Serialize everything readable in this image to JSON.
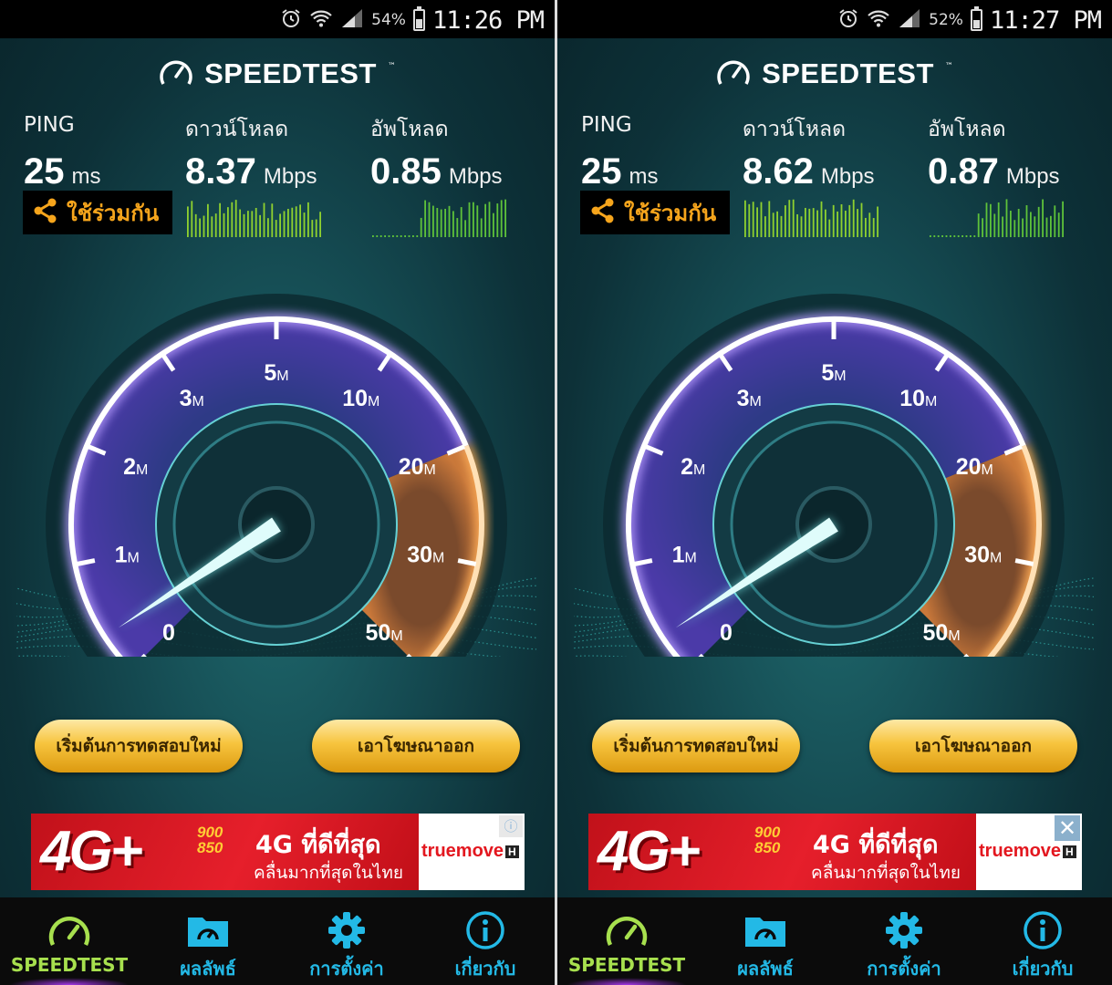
{
  "screens": [
    {
      "status_bar": {
        "battery_pct": "54%",
        "time": "11:26 PM",
        "battery_level": 0.54
      },
      "logo_text": "SPEEDTEST",
      "ping": {
        "label": "PING",
        "value": "25",
        "unit": "ms"
      },
      "download": {
        "label": "ดาวน์โหลด",
        "value": "8.37",
        "unit": "Mbps"
      },
      "upload": {
        "label": "อัพโหลด",
        "value": "0.85",
        "unit": "Mbps"
      },
      "share_label": "ใช้ร่วมกัน",
      "gauge_labels": [
        "0",
        "1M",
        "2M",
        "3M",
        "5M",
        "10M",
        "20M",
        "30M",
        "50M"
      ],
      "restart_button": "เริ่มต้นการทดสอบใหม่",
      "remove_ads_button": "เอาโฆษณาออก",
      "ad": {
        "logo": "4G+",
        "bands": [
          "900",
          "850"
        ],
        "headline": "4G ที่ดีที่สุด",
        "subline": "คลื่นมากที่สุดในไทย",
        "brand": "truemove",
        "brand_badge": "H",
        "corner_icon": "info-icon"
      },
      "nav": [
        {
          "label": "SPEEDTEST",
          "icon": "speedometer-icon",
          "active": true
        },
        {
          "label": "ผลลัพธ์",
          "icon": "results-folder-icon",
          "active": false
        },
        {
          "label": "การตั้งค่า",
          "icon": "gear-icon",
          "active": false
        },
        {
          "label": "เกี่ยวกับ",
          "icon": "info-icon",
          "active": false
        }
      ]
    },
    {
      "status_bar": {
        "battery_pct": "52%",
        "time": "11:27 PM",
        "battery_level": 0.52
      },
      "logo_text": "SPEEDTEST",
      "ping": {
        "label": "PING",
        "value": "25",
        "unit": "ms"
      },
      "download": {
        "label": "ดาวน์โหลด",
        "value": "8.62",
        "unit": "Mbps"
      },
      "upload": {
        "label": "อัพโหลด",
        "value": "0.87",
        "unit": "Mbps"
      },
      "share_label": "ใช้ร่วมกัน",
      "gauge_labels": [
        "0",
        "1M",
        "2M",
        "3M",
        "5M",
        "10M",
        "20M",
        "30M",
        "50M"
      ],
      "restart_button": "เริ่มต้นการทดสอบใหม่",
      "remove_ads_button": "เอาโฆษณาออก",
      "ad": {
        "logo": "4G+",
        "bands": [
          "900",
          "850"
        ],
        "headline": "4G ที่ดีที่สุด",
        "subline": "คลื่นมากที่สุดในไทย",
        "brand": "truemove",
        "brand_badge": "H",
        "corner_icon": "close-icon"
      },
      "nav": [
        {
          "label": "SPEEDTEST",
          "icon": "speedometer-icon",
          "active": true
        },
        {
          "label": "ผลลัพธ์",
          "icon": "results-folder-icon",
          "active": false
        },
        {
          "label": "การตั้งค่า",
          "icon": "gear-icon",
          "active": false
        },
        {
          "label": "เกี่ยวกับ",
          "icon": "info-icon",
          "active": false
        }
      ]
    }
  ],
  "colors": {
    "accent_orange": "#f6a51c",
    "nav_blue": "#23b9e6",
    "nav_active_green": "#a7e04e",
    "gauge_purple": "#6b4bd6",
    "gauge_orange": "#d88a3c"
  }
}
